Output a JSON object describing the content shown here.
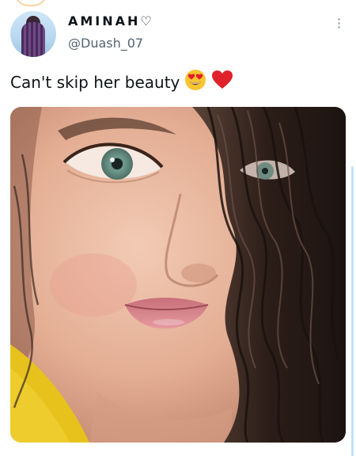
{
  "tweet": {
    "display_name": "AMINAH",
    "name_suffix_icon": "heart-outline-icon",
    "handle": "@Duash_07",
    "text": "Can't skip her beauty",
    "emojis": [
      "heart-eyes-emoji",
      "red-heart-emoji"
    ],
    "more_icon": "more-vertical-icon",
    "photo_description": "selfie-photo"
  },
  "colors": {
    "text_primary": "#0f1419",
    "text_secondary": "#536471",
    "heart_red": "#e0202a",
    "emoji_yellow": "#f7c531"
  }
}
